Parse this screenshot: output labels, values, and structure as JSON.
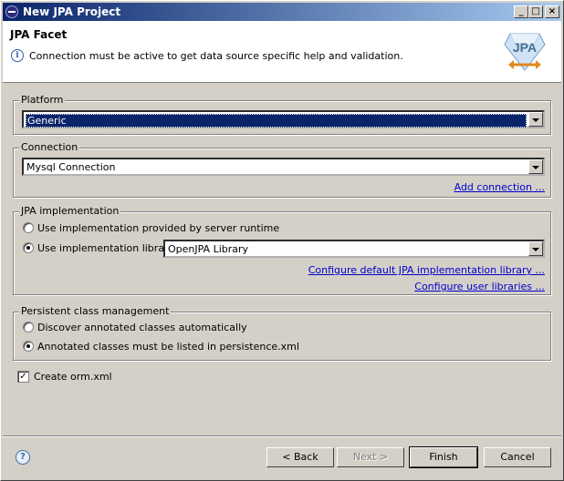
{
  "window": {
    "title": "New JPA Project",
    "buttons": {
      "minimize": "_",
      "maximize": "□",
      "close": "×"
    }
  },
  "header": {
    "title": "JPA Facet",
    "message": "Connection must be active to get data source specific help and validation.",
    "logo_text": "JPA"
  },
  "platform": {
    "legend": "Platform",
    "selected": "Generic"
  },
  "connection": {
    "legend": "Connection",
    "selected": "Mysql Connection",
    "add_link": "Add connection ..."
  },
  "jpa_impl": {
    "legend": "JPA implementation",
    "options": [
      {
        "label": "Use implementation provided by server runtime",
        "checked": false
      },
      {
        "label": "Use implementation library:",
        "checked": true
      }
    ],
    "library": "OpenJPA Library",
    "configure_default_link": "Configure default JPA implementation library ...",
    "configure_user_link": "Configure user libraries ..."
  },
  "persistent": {
    "legend": "Persistent class management",
    "options": [
      {
        "label": "Discover annotated classes automatically",
        "checked": false
      },
      {
        "label": "Annotated classes must be listed in persistence.xml",
        "checked": true
      }
    ]
  },
  "create_orm": {
    "label": "Create orm.xml",
    "checked": true,
    "mark": "✓"
  },
  "footer": {
    "help": "?",
    "back": "< Back",
    "next": "Next >",
    "finish": "Finish",
    "cancel": "Cancel"
  },
  "colors": {
    "title_bar": "#0a246a",
    "link": "#0000cc",
    "selection": "#0a246a"
  }
}
